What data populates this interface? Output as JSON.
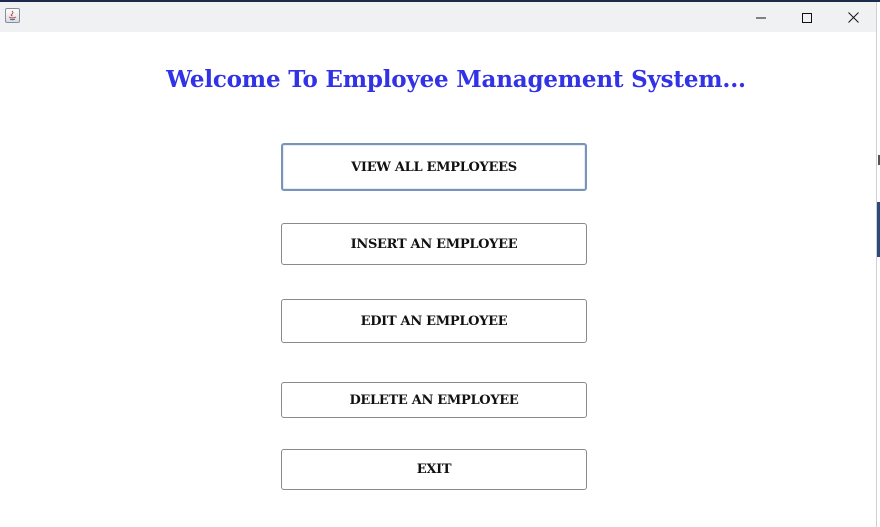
{
  "window": {
    "controls": {
      "minimize_icon": "minimize-icon",
      "maximize_icon": "maximize-icon",
      "close_icon": "close-icon"
    }
  },
  "main": {
    "welcome": "Welcome To Employee Management System...",
    "buttons": {
      "view_all": "VIEW ALL EMPLOYEES",
      "insert": "INSERT AN EMPLOYEE",
      "edit": "EDIT AN EMPLOYEE",
      "delete": "DELETE AN EMPLOYEE",
      "exit": "EXIT"
    }
  },
  "colors": {
    "welcome_text": "#3232e6",
    "titlebar_bg": "#f0f1f3",
    "focused_border": "#7a93b8"
  }
}
